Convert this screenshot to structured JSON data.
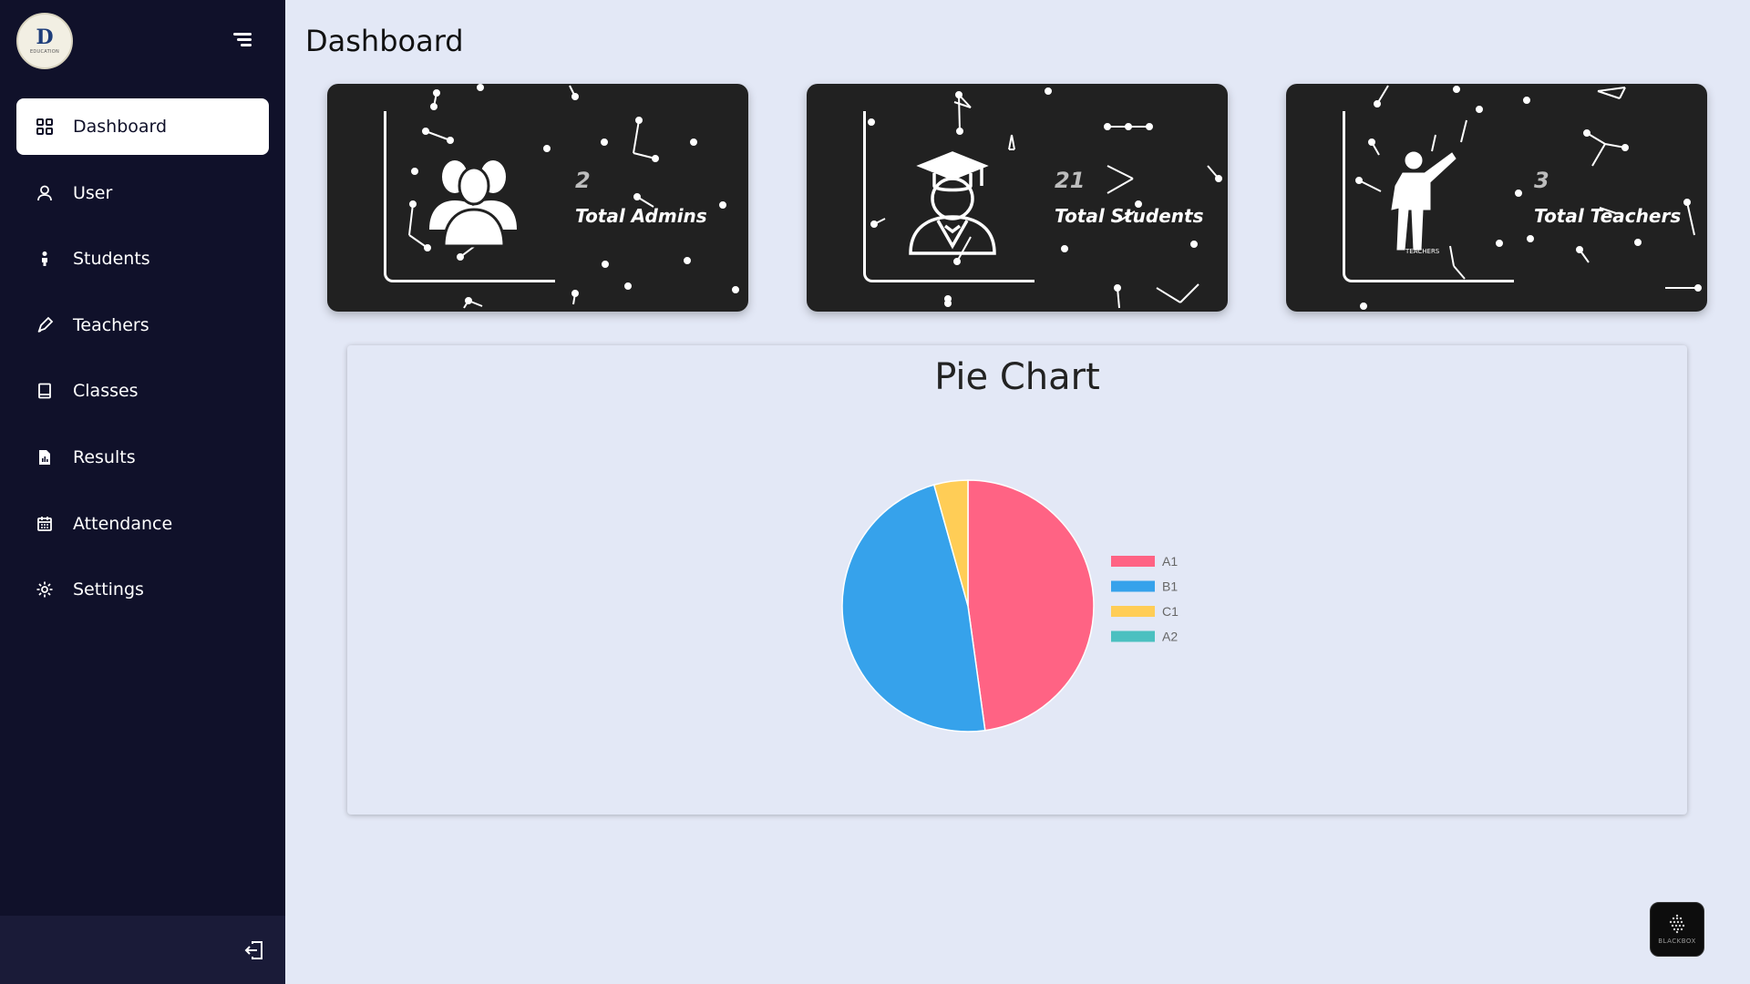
{
  "sidebar": {
    "logo": {
      "mark": "D",
      "text": "EDUCATION"
    },
    "items": [
      {
        "label": "Dashboard",
        "icon": "grid-icon",
        "active": true
      },
      {
        "label": "User",
        "icon": "user-icon",
        "active": false
      },
      {
        "label": "Students",
        "icon": "student-icon",
        "active": false
      },
      {
        "label": "Teachers",
        "icon": "teacher-icon",
        "active": false
      },
      {
        "label": "Classes",
        "icon": "book-icon",
        "active": false
      },
      {
        "label": "Results",
        "icon": "report-icon",
        "active": false
      },
      {
        "label": "Attendance",
        "icon": "calendar-icon",
        "active": false
      },
      {
        "label": "Settings",
        "icon": "gear-icon",
        "active": false
      }
    ]
  },
  "main": {
    "title": "Dashboard",
    "cards": [
      {
        "count": "2",
        "label": "Total Admins",
        "icon": "admins-icon"
      },
      {
        "count": "21",
        "label": "Total Students",
        "icon": "graduate-icon"
      },
      {
        "count": "3",
        "label": "Total Teachers",
        "icon": "teacher-pointing-icon",
        "icon_caption": "TEACHERS"
      }
    ]
  },
  "chart_data": {
    "type": "pie",
    "title": "Pie Chart",
    "categories": [
      "A1",
      "B1",
      "C1",
      "A2"
    ],
    "values": [
      11,
      11,
      1,
      0
    ],
    "colors": [
      "#ff6384",
      "#36a2eb",
      "#ffcd56",
      "#4bc0c0"
    ],
    "legend_position": "right"
  },
  "badge": {
    "label": "BLACKBOX",
    "icon": "blackbox-icon"
  },
  "colors": {
    "sidebar": "#10112a",
    "background": "#e3e8f6",
    "card": "#212121"
  }
}
